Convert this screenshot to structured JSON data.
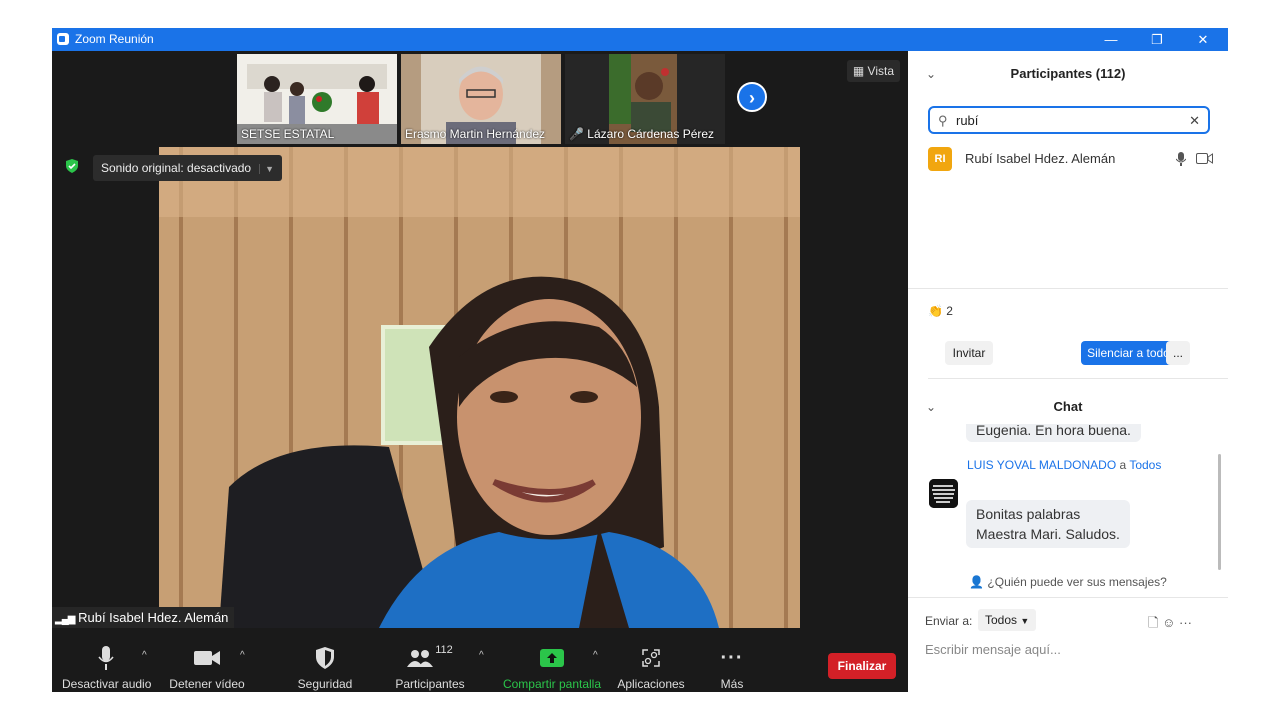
{
  "window": {
    "title": "Zoom Reunión",
    "minimize": "—",
    "restore": "❐",
    "close": "✕"
  },
  "stage": {
    "vista_label": "Vista",
    "thumbnails": [
      {
        "name": "SETSE ESTATAL"
      },
      {
        "name": "Erasmo Martin Hernández"
      },
      {
        "name": "Lázaro Cárdenas Pérez"
      }
    ],
    "sound_label": "Sonido original: desactivado",
    "speaker_name": "Rubí Isabel Hdez. Alemán"
  },
  "toolbar": {
    "audio": "Desactivar audio",
    "video": "Detener vídeo",
    "security": "Seguridad",
    "participants": "Participantes",
    "participants_count": "112",
    "share": "Compartir pantalla",
    "apps": "Aplicaciones",
    "more": "Más",
    "end": "Finalizar"
  },
  "participants_panel": {
    "title": "Participantes (112)",
    "search_value": "rubí",
    "results": [
      {
        "initials": "RI",
        "name": "Rubí Isabel Hdez. Alemán"
      }
    ],
    "reactions_count": "2",
    "invite": "Invitar",
    "mute_all": "Silenciar a todos",
    "more": "..."
  },
  "chat": {
    "title": "Chat",
    "prev_message": "Eugenia. En hora buena.",
    "sender": "LUIS YOVAL MALDONADO",
    "to_word": "a",
    "recipient": "Todos",
    "message_line1": "Bonitas palabras",
    "message_line2": "Maestra Mari. Saludos.",
    "who_can_see": "¿Quién puede ver sus mensajes?",
    "send_to_label": "Enviar a:",
    "send_to_value": "Todos",
    "input_placeholder": "Escribir mensaje aquí..."
  },
  "colors": {
    "accent": "#1a73e8",
    "end_button": "#d32027",
    "share_green": "#2bc54a",
    "avatar_orange": "#f1a60f"
  }
}
